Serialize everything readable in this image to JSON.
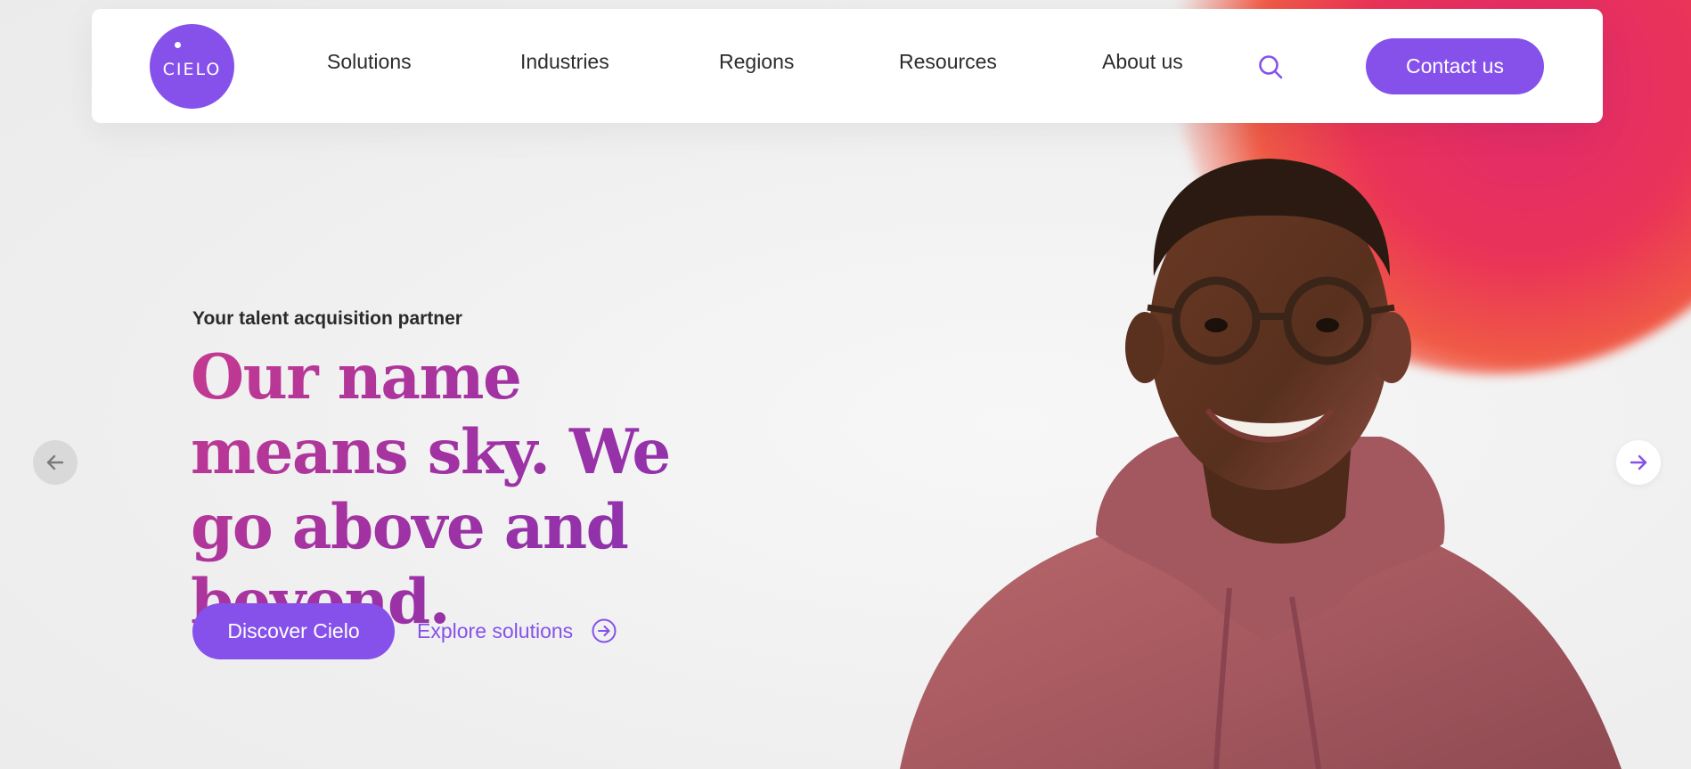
{
  "brand": {
    "logo_text": "CIELO",
    "accent_color": "#8651ea"
  },
  "nav": {
    "items": [
      {
        "label": "Solutions"
      },
      {
        "label": "Industries"
      },
      {
        "label": "Regions"
      },
      {
        "label": "Resources"
      },
      {
        "label": "About us"
      }
    ],
    "search_icon": "search-icon",
    "contact_label": "Contact us"
  },
  "hero": {
    "eyebrow": "Your talent acquisition partner",
    "headline": "Our name means sky. We go above and beyond.",
    "primary_cta": "Discover Cielo",
    "secondary_cta": "Explore solutions",
    "secondary_cta_icon": "arrow-right-circle-icon",
    "image": "smiling man with glasses in pink hoodie",
    "headline_gradient": [
      "#c63a8f",
      "#8231b4"
    ]
  },
  "carousel": {
    "prev_icon": "arrow-left-icon",
    "next_icon": "arrow-right-icon"
  }
}
